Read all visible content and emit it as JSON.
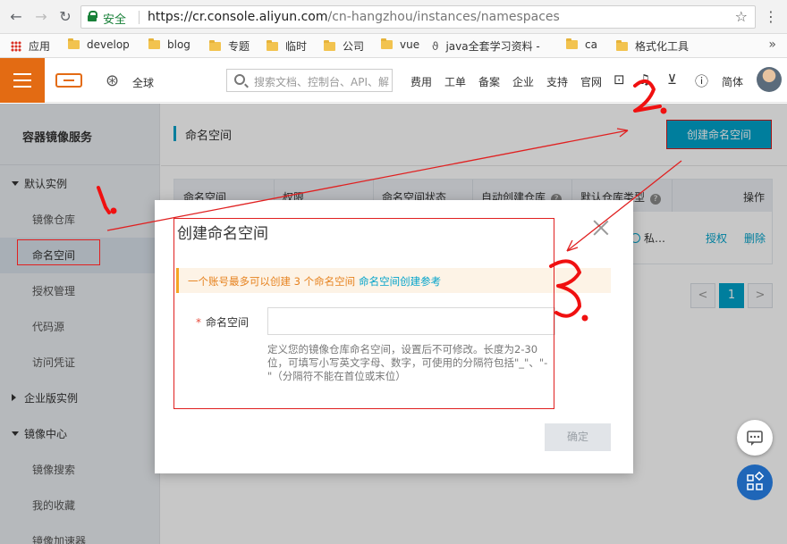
{
  "browser": {
    "secure_label": "安全",
    "url_host": "https://cr.console.aliyun.com",
    "url_path": "/cn-hangzhou/instances/namespaces",
    "bookmarks": [
      "应用",
      "develop",
      "blog",
      "专题",
      "临时",
      "公司",
      "vue",
      "java全套学习资料 -",
      "ca",
      "格式化工具"
    ],
    "more": "»"
  },
  "header": {
    "region": "全球",
    "search_placeholder": "搜索文档、控制台、API、解",
    "nav": [
      "费用",
      "工单",
      "备案",
      "企业",
      "支持",
      "官网"
    ],
    "lang": "简体"
  },
  "sidebar": {
    "title": "容器镜像服务",
    "groups": [
      {
        "label": "默认实例",
        "expanded": true,
        "items": [
          "镜像仓库",
          "命名空间",
          "授权管理",
          "代码源",
          "访问凭证"
        ]
      },
      {
        "label": "企业版实例",
        "expanded": false,
        "items": []
      },
      {
        "label": "镜像中心",
        "expanded": true,
        "items": [
          "镜像搜索",
          "我的收藏",
          "镜像加速器"
        ]
      }
    ],
    "active_item": "命名空间"
  },
  "main": {
    "title": "命名空间",
    "create_button": "创建命名空间",
    "table": {
      "columns": [
        "命名空间",
        "权限",
        "命名空间状态",
        "自动创建仓库",
        "默认仓库类型",
        "操作"
      ],
      "row": {
        "type_value": "私…",
        "actions": [
          "授权",
          "删除"
        ],
        "separator": "|"
      }
    },
    "pagination": {
      "prev": "<",
      "current": "1",
      "next": ">"
    }
  },
  "modal": {
    "title": "创建命名空间",
    "notice": "一个账号最多可以创建 3 个命名空间",
    "notice_link": "命名空间创建参考",
    "required_mark": "*",
    "field_label": "命名空间",
    "field_value": "",
    "help": "定义您的镜像仓库命名空间，设置后不可修改。长度为2-30位，可填写小写英文字母、数字，可使用的分隔符包括\"_\"、\"-\"（分隔符不能在首位或末位）",
    "ok_button": "确定"
  },
  "colors": {
    "accent": "#00a2ca",
    "brand": "#e36b13",
    "annotation": "#e02020",
    "warning": "#f5a623"
  }
}
